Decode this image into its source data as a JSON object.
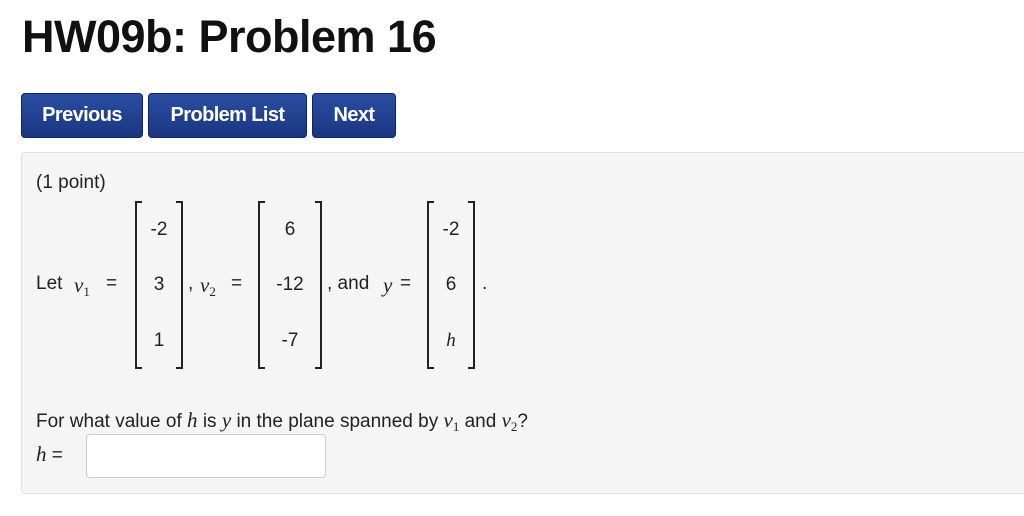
{
  "page": {
    "title": "HW09b: Problem 16"
  },
  "nav": {
    "previous_label": "Previous",
    "problem_list_label": "Problem List",
    "next_label": "Next"
  },
  "problem": {
    "points": "(1 point)",
    "let_label": "Let",
    "v1_var": "v",
    "v1_sub": "1",
    "v2_var": "v",
    "v2_sub": "2",
    "equals": "=",
    "comma": ",",
    "and_label": ", and",
    "y_var": "y",
    "period": ".",
    "v1": [
      "-2",
      "3",
      "1"
    ],
    "v2": [
      "6",
      "-12",
      "-7"
    ],
    "y": [
      "-2",
      "6",
      "h"
    ],
    "question_part1": "For what value of",
    "question_h": "h",
    "question_part2": "is",
    "question_y": "y",
    "question_part3": "in the plane spanned by",
    "question_and": "and",
    "question_end": "?",
    "answer_label_var": "h",
    "answer_value": ""
  }
}
